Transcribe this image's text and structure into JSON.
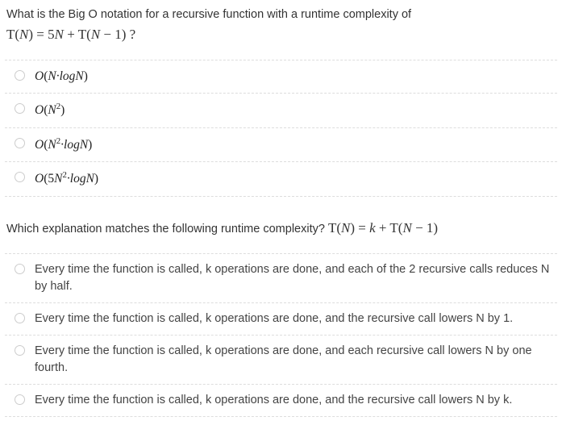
{
  "q1": {
    "prompt_part1": "What is the Big O notation for a recursive function with a runtime complexity of",
    "prompt_formula": "T(N) = 5N + T(N − 1) ?",
    "options": [
      "O(N·logN)",
      "O(N²)",
      "O(N²·logN)",
      "O(5N²·logN)"
    ]
  },
  "q2": {
    "prompt_part1": "Which explanation matches the following runtime complexity? ",
    "prompt_formula": "T(N) = k + T(N − 1)",
    "options": [
      "Every time the function is called, k operations are done, and each of the 2 recursive calls reduces N by half.",
      "Every time the function is called, k operations are done, and the recursive call lowers N by 1.",
      "Every time the function is called, k operations are done, and each recursive call lowers N by one fourth.",
      "Every time the function is called, k operations are done, and the recursive call lowers N by k."
    ]
  }
}
